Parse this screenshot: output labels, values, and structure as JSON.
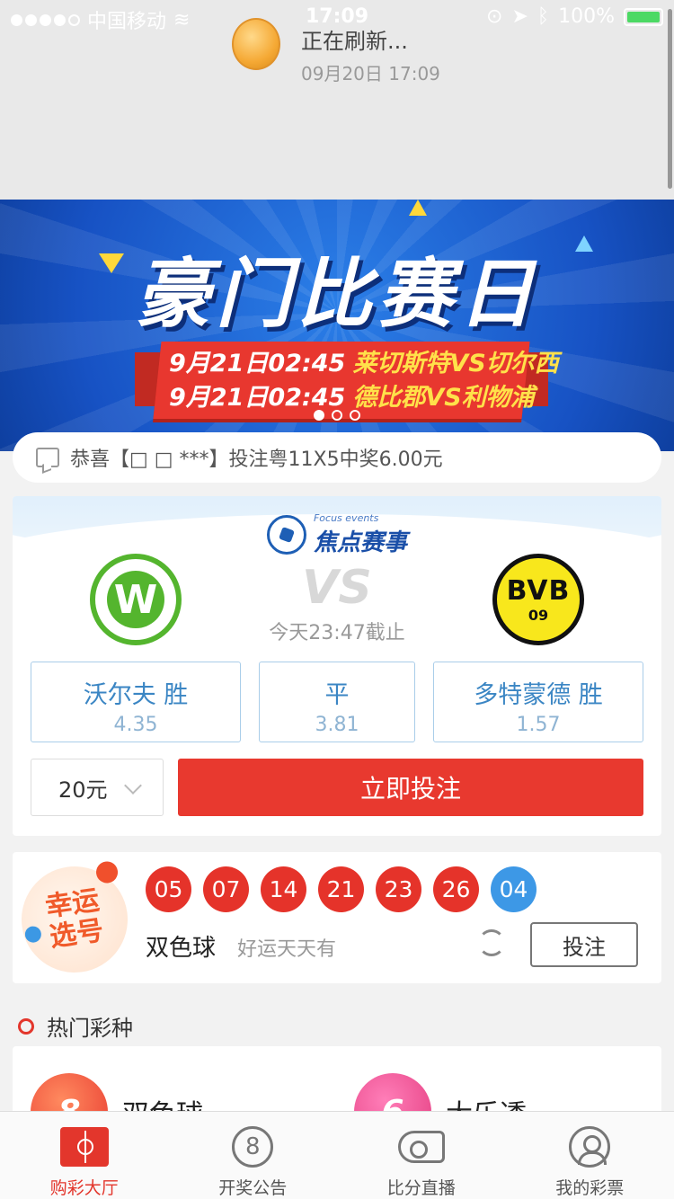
{
  "status_bar": {
    "carrier": "中国移动",
    "time": "17:09",
    "battery": "100%"
  },
  "refresh": {
    "title": "正在刷新...",
    "time": "09月20日 17:09"
  },
  "banner": {
    "title": "豪门比赛日",
    "lines": [
      {
        "date": "9月21日02:45",
        "match": "莱切斯特VS切尔西"
      },
      {
        "date": "9月21日02:45",
        "match": "德比郡VS利物浦"
      }
    ]
  },
  "notice": {
    "text": "恭喜【□ □ ***】投注粤11X5中奖6.00元"
  },
  "focus": {
    "title_en": "Focus events",
    "title_cn": "焦点赛事",
    "home_logo_text": "W",
    "away_logo_text": "BVB",
    "away_logo_sub": "09",
    "vs": "VS",
    "deadline": "今天23:47截止",
    "odds": [
      {
        "name": "沃尔夫 胜",
        "value": "4.35"
      },
      {
        "name": "平",
        "value": "3.81"
      },
      {
        "name": "多特蒙德 胜",
        "value": "1.57"
      }
    ],
    "amount": "20元",
    "bet_button": "立即投注"
  },
  "lucky": {
    "badge_text_1": "幸运",
    "badge_text_2": "选号",
    "red_balls": [
      "05",
      "07",
      "14",
      "21",
      "23",
      "26"
    ],
    "blue_ball": "04",
    "name": "双色球",
    "slogan": "好运天天有",
    "button": "投注"
  },
  "hot": {
    "title": "热门彩种",
    "items": [
      {
        "name": "双色球",
        "icon_text": "8"
      },
      {
        "name": "大乐透",
        "icon_text": "6"
      }
    ]
  },
  "tabbar": {
    "tabs": [
      {
        "label": "购彩大厅"
      },
      {
        "label": "开奖公告",
        "icon_text": "8"
      },
      {
        "label": "比分直播"
      },
      {
        "label": "我的彩票"
      }
    ]
  },
  "colors": {
    "accent_red": "#e8392f",
    "odds_blue": "#3b86c4",
    "banner_blue": "#1752c4"
  }
}
